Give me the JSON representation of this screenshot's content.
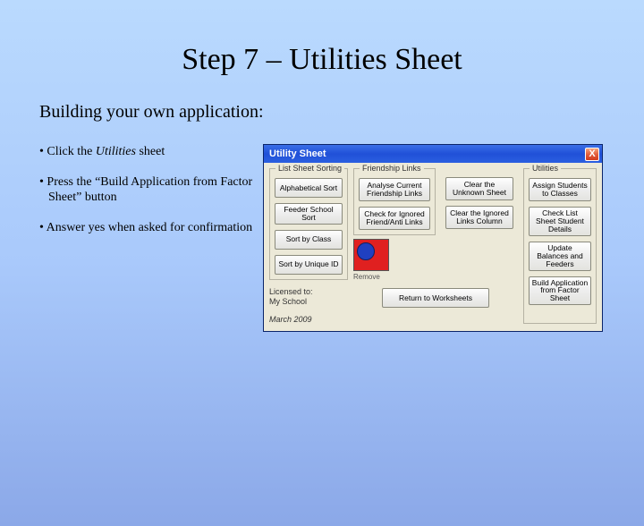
{
  "title": "Step 7 – Utilities Sheet",
  "subtitle": "Building your own application:",
  "bullets": {
    "b1_pre": "• Click the ",
    "b1_em": "Utilities",
    "b1_post": " sheet",
    "b2": "• Press the “Build Application from Factor Sheet” button",
    "b3": "• Answer yes when asked for confirmation"
  },
  "window": {
    "title": "Utility Sheet",
    "close": "X",
    "groups": {
      "sorting": "List Sheet Sorting",
      "links": "Friendship Links",
      "utilities": "Utilities"
    },
    "buttons": {
      "alpha": "Alphabetical Sort",
      "feeder": "Feeder School Sort",
      "class": "Sort by Class",
      "unique": "Sort by Unique ID",
      "analyse": "Analyse Current Friendship Links",
      "ignored": "Check for Ignored Friend/Anti Links",
      "clearunk": "Clear the Unknown Sheet",
      "clearign": "Clear the Ignored Links Column",
      "assign": "Assign Students to Classes",
      "checklist": "Check List Sheet Student Details",
      "update": "Update Balances and Feeders",
      "build": "Build Application from Factor Sheet",
      "return": "Return to Worksheets"
    },
    "license1": "Licensed to:",
    "license2": "My School",
    "date": "March 2009",
    "swatch": "Remove"
  }
}
